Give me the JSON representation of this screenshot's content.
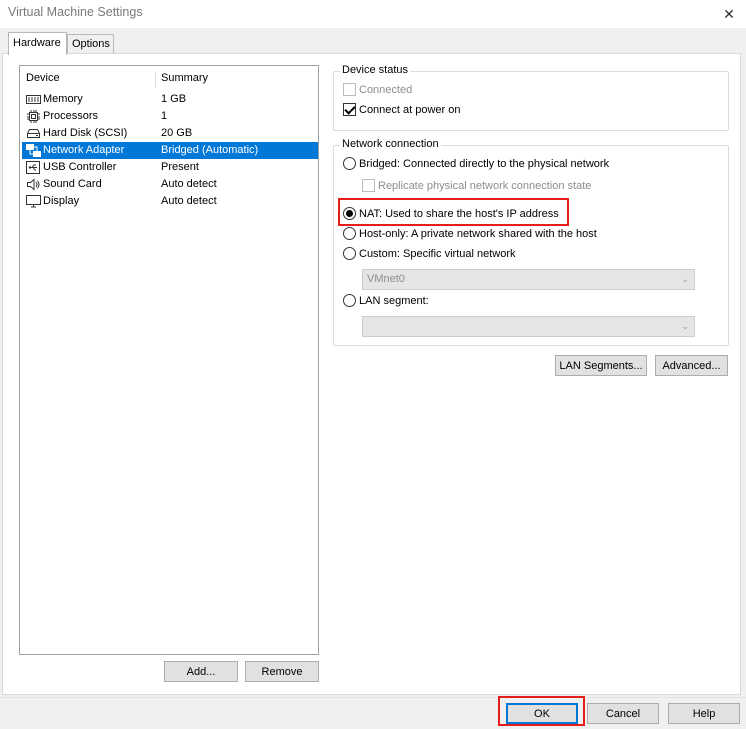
{
  "window": {
    "title": "Virtual Machine Settings",
    "close_glyph": "✕"
  },
  "tabs": [
    {
      "label": "Hardware"
    },
    {
      "label": "Options"
    }
  ],
  "device_list": {
    "columns": [
      "Device",
      "Summary"
    ],
    "rows": [
      {
        "icon": "memory-icon",
        "device": "Memory",
        "summary": "1 GB"
      },
      {
        "icon": "processor-icon",
        "device": "Processors",
        "summary": "1"
      },
      {
        "icon": "hard-disk-icon",
        "device": "Hard Disk (SCSI)",
        "summary": "20 GB"
      },
      {
        "icon": "network-adapter-icon",
        "device": "Network Adapter",
        "summary": "Bridged (Automatic)",
        "selected": true
      },
      {
        "icon": "usb-icon",
        "device": "USB Controller",
        "summary": "Present"
      },
      {
        "icon": "sound-icon",
        "device": "Sound Card",
        "summary": "Auto detect"
      },
      {
        "icon": "display-icon",
        "device": "Display",
        "summary": "Auto detect"
      }
    ],
    "add_label": "Add...",
    "remove_label": "Remove"
  },
  "device_status": {
    "title": "Device status",
    "connected": {
      "label": "Connected",
      "checked": false,
      "disabled": true
    },
    "connect_at_power_on": {
      "label": "Connect at power on",
      "checked": true
    }
  },
  "network_connection": {
    "title": "Network connection",
    "bridged": {
      "label": "Bridged: Connected directly to the physical network",
      "selected": false
    },
    "replicate": {
      "label": "Replicate physical network connection state",
      "checked": false,
      "disabled": true
    },
    "nat": {
      "label": "NAT: Used to share the host's IP address",
      "selected": true
    },
    "host_only": {
      "label": "Host-only: A private network shared with the host",
      "selected": false
    },
    "custom": {
      "label": "Custom: Specific virtual network",
      "selected": false
    },
    "custom_value": "VMnet0",
    "lan_segment": {
      "label": "LAN segment:",
      "selected": false
    },
    "lan_segment_value": ""
  },
  "panel_buttons": {
    "lan_segments": "LAN Segments...",
    "advanced": "Advanced..."
  },
  "dialog_buttons": {
    "ok": "OK",
    "cancel": "Cancel",
    "help": "Help"
  },
  "colors": {
    "selection": "#0078d7",
    "highlight": "#e41d1d"
  }
}
